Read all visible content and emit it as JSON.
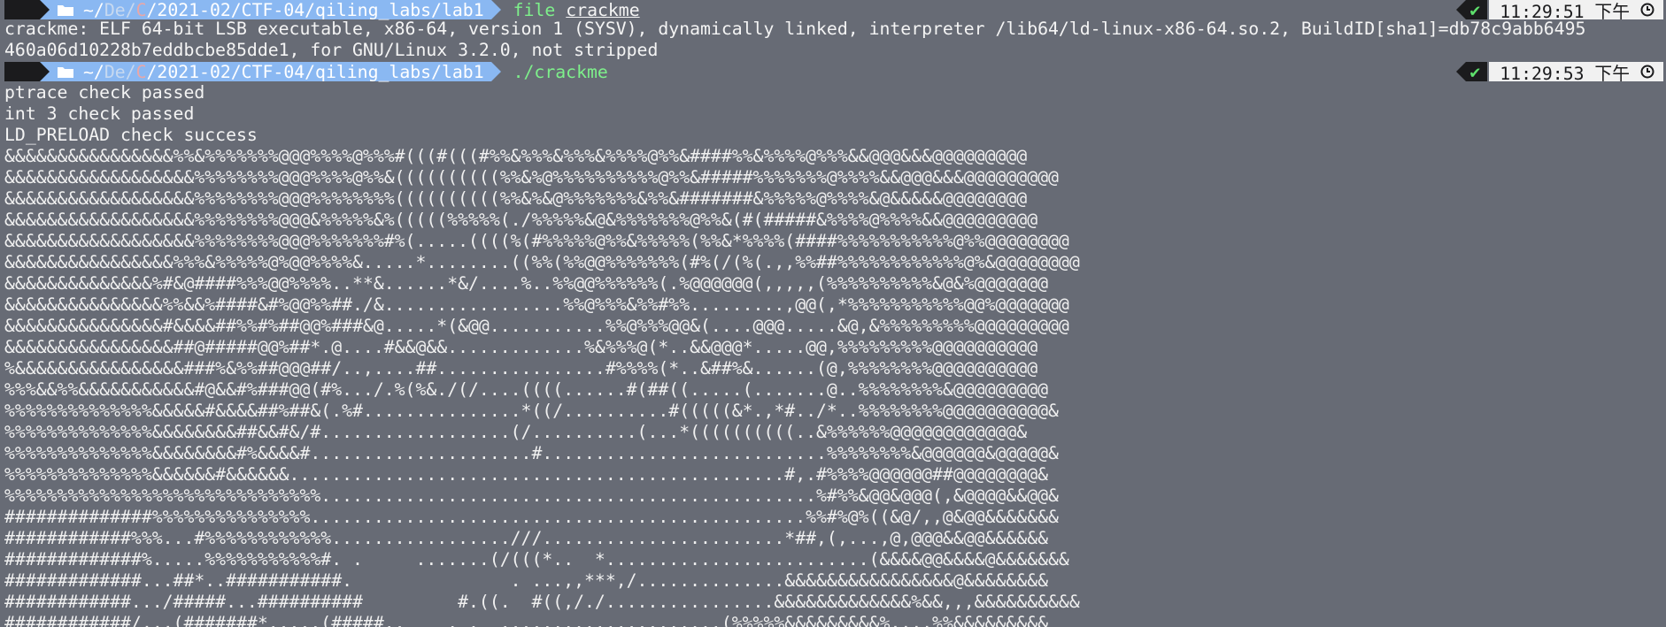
{
  "prompt1": {
    "path_prefix": "~/",
    "path_dim1": "De",
    "path_slash1": "/",
    "path_red": "C",
    "path_rest": "/2021-02/CTF-04/qiling_labs/lab1",
    "command": "file",
    "argument": "crackme",
    "status": "✔",
    "time": "11:29:51 下午"
  },
  "output1": [
    "crackme: ELF 64-bit LSB executable, x86-64, version 1 (SYSV), dynamically linked, interpreter /lib64/ld-linux-x86-64.so.2, BuildID[sha1]=db78c9abb6495",
    "460a06d10228b7eddbcbe85dde1, for GNU/Linux 3.2.0, not stripped"
  ],
  "prompt2": {
    "path_prefix": "~/",
    "path_dim1": "De",
    "path_slash1": "/",
    "path_red": "C",
    "path_rest": "/2021-02/CTF-04/qiling_labs/lab1",
    "command": "./crackme",
    "status": "✔",
    "time": "11:29:53 下午"
  },
  "output2": [
    "ptrace check passed",
    "int 3 check passed",
    "LD_PRELOAD check success"
  ],
  "ascii_art": [
    "&&&&&&&&&&&&&&&&%%&%%%%%%%@@@%%%%@%%%#(((#(((#%%&%%%&%%%&%%%%@%%&####%%&%%%%@%%%&&@@@&&&@@@@@@@@@",
    "&&&&&&&&&&&&&&&&&&%%%%%%%%@@@%%%%@%%&((((((((((%%&%@%%%%%%%%%%@%%&#####%%%%%%%@%%%%&&@@@&&&@@@@@@@@@",
    "&&&&&&&&&&&&&&&&&&%%%%%%%%@@@%%%%%%%%((((((((((%%&%&@%%%%%%%&%%&#######&%%%%%@%%%%&@&&&&&@@@@@@@@",
    "&&&&&&&&&&&&&&&&&&%%%%%%%%@@@&%%%%%&%(((((%%%%%(./%%%%%&@&%%%%%%%@%%&(#(#####&%%%%@%%%%&&@@@@@@@@@",
    "&&&&&&&&&&&&&&&&&&%%%%%%%%@@@%%%%%%%#%(.....((((%(#%%%%%@%%&%%%%%(%%&*%%%%(####%%%%%%%%%%%@%%@@@@@@@@",
    "&&&&&&&&&&&&&&&&%%%&%%%%%@%@@%%%%&.....*........((%%(%%@@%%%%%%%(#%(/(%(.,,%%##%%%%%%%%%%%%@%&@@@@@@@@",
    "&&&&&&&&&&&&&&%#&@####%%%@@%%%%..**&......*&/....%..%%@@%%%%%%(.%@@@@@@(,,,,,(%%%%%%%%%%&@&%@@@@@@@",
    "&&&&&&&&&&&&&&&%%&&%####&#%@@%%##./&.................%%@%%%&%%#%%.........,@@(,*%%%%%%%%%%%@@%@@@@@@@",
    "&&&&&&&&&&&&&&&#&&&&##%%#%##@@%###&@.....*(&@@...........%%@%%%@@&(....@@@.....&@,&%%%%%%%%%@@@@@@@@@",
    "&&&&&&&&&&&&&&&&##@#####@@%##*.@....#&&@&&.............%&%%%@(*..&&@@@*.....@@,%%%%%%%%%@@@@@@@@@@",
    "%&&&&&&&&&&&&&&&&###%&%%##@@@##/..,....##................#%%%%(*..&##%&......(@,%%%%%%%%@@@@@@@@@@",
    "%%%&&%%&&&&&&&&&&&#@&&#%###@@(#%.../.%(%&./(/....((((......#(##((.....(.......@..%%%%%%%%&@@@@@@@@@",
    "%%%%%%%%%%%%%%&&&&&#&&&&##%##&(.%#...............*((/..........#(((((&*.,*#../*..%%%%%%%%@@@@@@@@@@&",
    "%%%%%%%%%%%%%%&&&&&&&&##&&#&/#..................(/..........(...*((((((((((..&%%%%%%@@@@@@@@@@@@&",
    "%%%%%%%%%%%%%%&&&&&&&&#%&&&&#.....................#...........................%%%%%%%%&@@@@@@&@@@@@&",
    "%%%%%%%%%%%%%%&&&&&&#&&&&&&...............................................#,.#%%%%@@@@@@##@@@@@@@@&",
    "%%%%%%%%%%%%%%%%%%%%%%%%%%%%%%...............................................%#%%&@@&@@@(,&@@@@&&@@&",
    "##############%%%%%%%%%%%%%%%...............................................%%#%@%((&@/,,@&@@&&&&&&&",
    "############%%%...#%%%%%%%%%%%%.................///.......................*##,(,...,@,@@@&&@@&&&&&&",
    "#############%.....%%%%%%%%%%%#. .     .......(/(((*..  *.........................(&&&&@@&&&&@&&&&&&&",
    "#############...##*..###########.               . ...,,***,/..............&&&&&&&&&&&&&&&&@&&&&&&&&",
    "############.../#####...##########         #.((.  #((,/./................&&&&&&&&&&&&&%&&,,,&&&&&&&&&&",
    "############/,,,(#######*.....(#####..    . .  .....................(%%%%%&&&&&&&&&%,,,,%%&&&&&&&&&"
  ],
  "colors": {
    "background": "#676b75",
    "path_segment": "#8ab8f2",
    "os_segment": "#1b1b1d",
    "command_green": "#7ef08b",
    "status_green": "#5ee06c",
    "time_segment": "#f1f1f1"
  },
  "icons": {
    "os": "arch-linux-icon",
    "folder": "folder-icon",
    "clock": "clock-icon"
  }
}
